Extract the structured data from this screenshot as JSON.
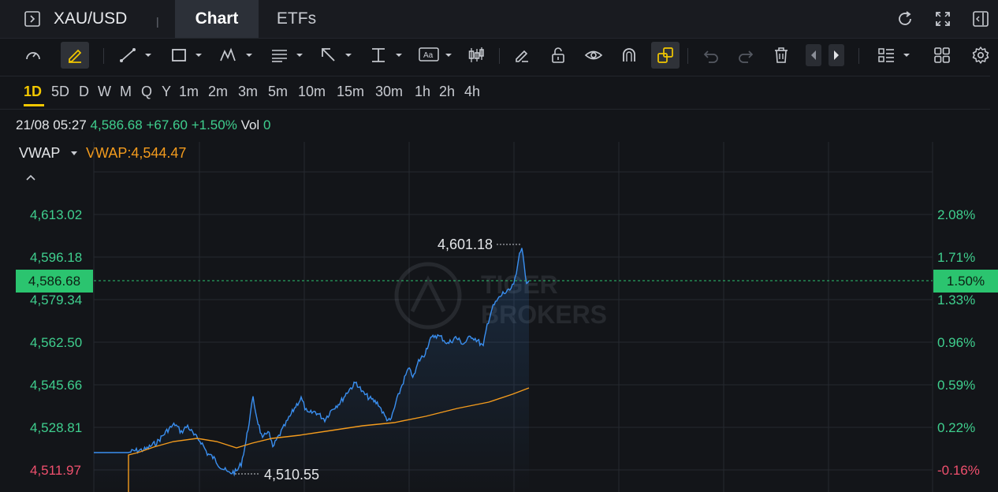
{
  "header": {
    "symbol": "XAU/USD",
    "separator": "|",
    "tabs": [
      {
        "label": "Chart",
        "active": true
      },
      {
        "label": "ETFs",
        "active": false
      }
    ]
  },
  "toolbar": {
    "text_tool_label": "Aa",
    "icons": [
      "speedometer-icon",
      "highlighter-icon",
      "trend-line-icon",
      "rectangle-icon",
      "pattern-icon",
      "fib-icon",
      "arrow-icon",
      "price-range-icon",
      "text-icon",
      "candlestick-icon",
      "eraser-icon",
      "lock-icon",
      "eye-icon",
      "magnet-icon",
      "link-icon",
      "undo-icon",
      "redo-icon",
      "trash-icon",
      "prev-icon",
      "next-icon",
      "layout-icon",
      "grid-icon",
      "gear-icon"
    ]
  },
  "timeframes": [
    "1D",
    "5D",
    "D",
    "W",
    "M",
    "Q",
    "Y",
    "1m",
    "2m",
    "3m",
    "5m",
    "10m",
    "15m",
    "30m",
    "1h",
    "2h",
    "4h"
  ],
  "active_timeframe": "1D",
  "info": {
    "datetime": "21/08 05:27",
    "price": "4,586.68",
    "change": "+67.60",
    "change_pct": "+1.50%",
    "vol_label": "Vol",
    "vol_value": "0"
  },
  "indicator": {
    "name": "VWAP",
    "value_label": "VWAP:4,544.47"
  },
  "y_axis_left": [
    "4,613.02",
    "4,596.18",
    "4,579.34",
    "4,562.50",
    "4,545.66",
    "4,528.81",
    "4,511.97"
  ],
  "y_axis_right": [
    "2.08%",
    "1.71%",
    "1.33%",
    "0.96%",
    "0.59%",
    "0.22%",
    "-0.16%"
  ],
  "current_price_tag": "4,586.68",
  "current_pct_tag": "1.50%",
  "annotations": {
    "high": "4,601.18",
    "low": "4,510.55"
  },
  "colors": {
    "up": "#3fcf8e",
    "down": "#f0506e",
    "price_line": "#3a8ff0",
    "vwap_line": "#f39b1d",
    "accent": "#f3c800"
  }
}
